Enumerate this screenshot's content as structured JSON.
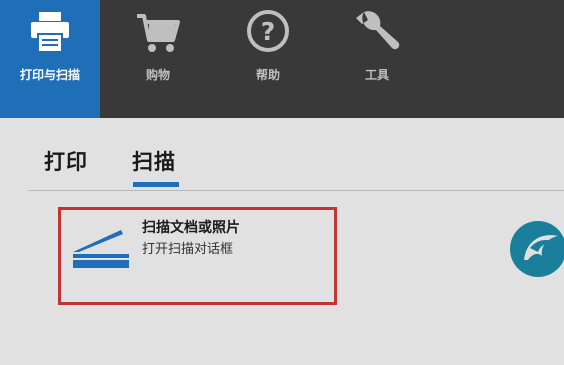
{
  "nav": {
    "items": [
      {
        "label": "打印与扫描",
        "icon": "printer-icon",
        "active": true
      },
      {
        "label": "购物",
        "icon": "cart-icon",
        "active": false
      },
      {
        "label": "帮助",
        "icon": "help-icon",
        "active": false
      },
      {
        "label": "工具",
        "icon": "wrench-icon",
        "active": false
      }
    ]
  },
  "tabs": [
    {
      "label": "打印",
      "active": false
    },
    {
      "label": "扫描",
      "active": true
    }
  ],
  "scan_action": {
    "title": "扫描文档或照片",
    "subtitle": "打开扫描对话框",
    "icon": "scanner-icon"
  },
  "logo": {
    "icon": "brand-logo-icon"
  },
  "colors": {
    "topbar": "#393939",
    "accent": "#1f6eb8",
    "highlight_border": "#c43333",
    "background": "#e1e1e1"
  }
}
